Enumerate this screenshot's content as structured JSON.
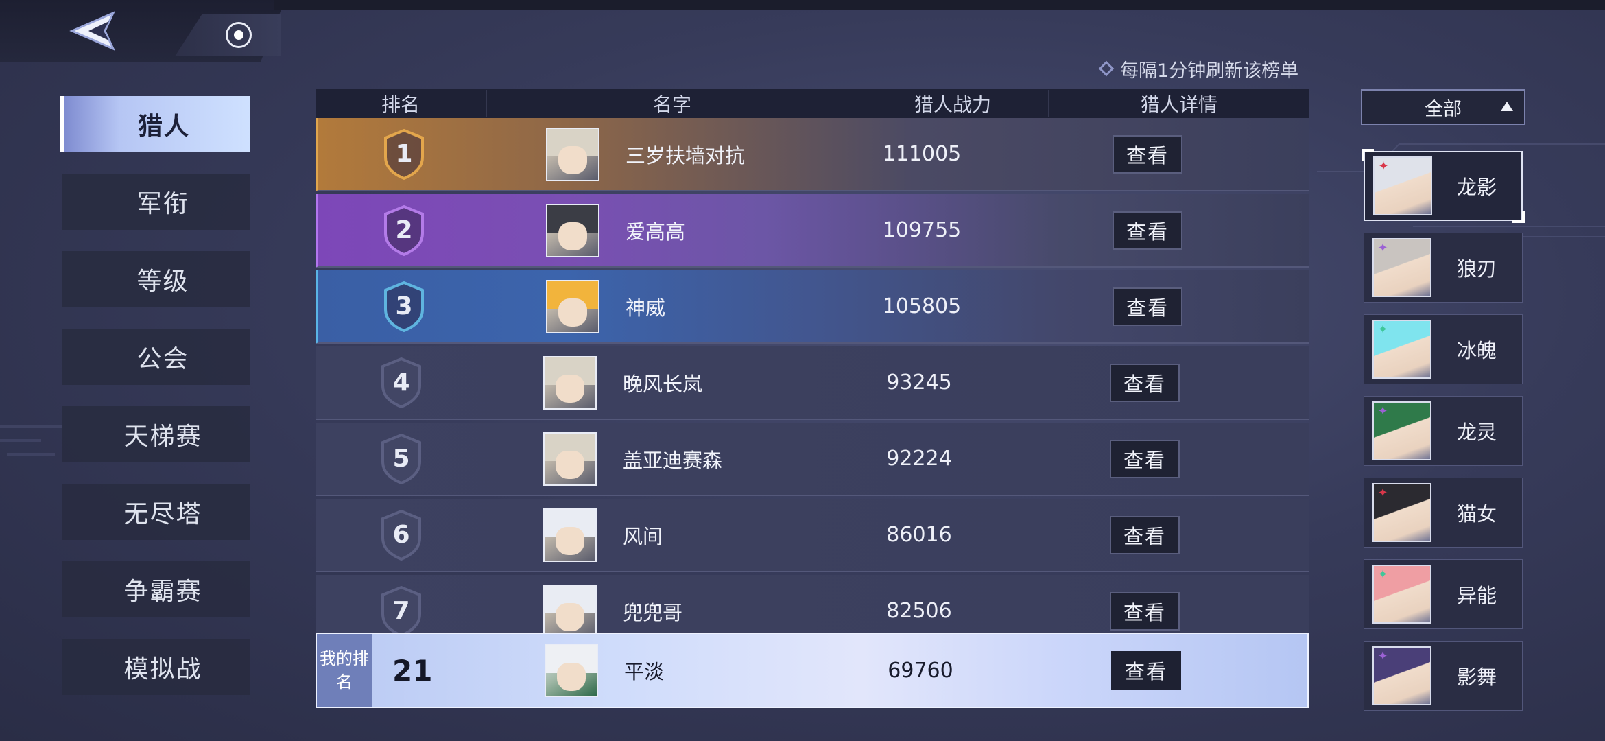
{
  "header": {
    "back_icon": "double-chevron-left-icon",
    "home_icon": "home-dot-icon"
  },
  "refresh_note": "每隔1分钟刷新该榜单",
  "nav": {
    "items": [
      {
        "label": "猎人",
        "active": true
      },
      {
        "label": "军衔",
        "active": false
      },
      {
        "label": "等级",
        "active": false
      },
      {
        "label": "公会",
        "active": false
      },
      {
        "label": "天梯赛",
        "active": false
      },
      {
        "label": "无尽塔",
        "active": false
      },
      {
        "label": "争霸赛",
        "active": false
      },
      {
        "label": "模拟战",
        "active": false
      }
    ]
  },
  "table": {
    "headers": {
      "rank": "排名",
      "name": "名字",
      "power": "猎人战力",
      "detail": "猎人详情"
    },
    "rows": [
      {
        "rank": "1",
        "name": "三岁扶墙对抗",
        "power": "111005",
        "button": "查看",
        "badge_color": "#e3a64c",
        "hair": "#d9d3c6"
      },
      {
        "rank": "2",
        "name": "爱高高",
        "power": "109755",
        "button": "查看",
        "badge_color": "#b37be8",
        "hair": "#3b3d45"
      },
      {
        "rank": "3",
        "name": "神威",
        "power": "105805",
        "button": "查看",
        "badge_color": "#5fb4df",
        "hair": "#f2b43c"
      },
      {
        "rank": "4",
        "name": "晚风长岚",
        "power": "93245",
        "button": "查看",
        "badge_color": "#5b5f82",
        "hair": "#d9d3c6"
      },
      {
        "rank": "5",
        "name": "盖亚迪赛森",
        "power": "92224",
        "button": "查看",
        "badge_color": "#5b5f82",
        "hair": "#d9d3c6"
      },
      {
        "rank": "6",
        "name": "风间",
        "power": "86016",
        "button": "查看",
        "badge_color": "#5b5f82",
        "hair": "#e9ecf3"
      },
      {
        "rank": "7",
        "name": "兜兜哥",
        "power": "82506",
        "button": "查看",
        "badge_color": "#5b5f82",
        "hair": "#e9ecf3"
      }
    ]
  },
  "my_rank": {
    "label": "我的排名",
    "rank": "21",
    "name": "平淡",
    "power": "69760",
    "button": "查看"
  },
  "filter": {
    "label": "全部"
  },
  "characters": [
    {
      "name": "龙影",
      "selected": true,
      "hair": "#dfe2ea",
      "rune_color": "#d9374a"
    },
    {
      "name": "狼刃",
      "selected": false,
      "hair": "#c9c4c0",
      "rune_color": "#9b61d4"
    },
    {
      "name": "冰魄",
      "selected": false,
      "hair": "#7fe4ee",
      "rune_color": "#3fc79a"
    },
    {
      "name": "龙灵",
      "selected": false,
      "hair": "#2f7a4a",
      "rune_color": "#9b61d4"
    },
    {
      "name": "猫女",
      "selected": false,
      "hair": "#2b2a30",
      "rune_color": "#d9374a"
    },
    {
      "name": "异能",
      "selected": false,
      "hair": "#ef9ea3",
      "rune_color": "#3fc79a"
    },
    {
      "name": "影舞",
      "selected": false,
      "hair": "#4a3f78",
      "rune_color": "#9b61d4"
    }
  ]
}
